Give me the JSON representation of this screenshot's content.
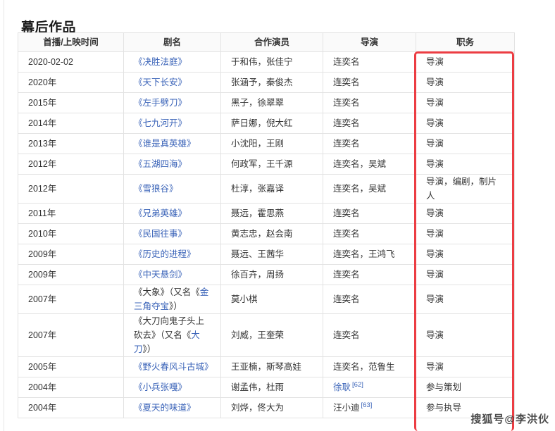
{
  "page": {
    "section_title": "幕后作品",
    "watermark": "搜狐号@李洪伙"
  },
  "annotation": {
    "type": "red-rectangle-highlight",
    "target_column": "职务",
    "color": "#ec3d43"
  },
  "table": {
    "headers": [
      "首播/上映时间",
      "剧名",
      "合作演员",
      "导演",
      "职务"
    ],
    "rows": [
      {
        "date": "2020-02-02",
        "title": "《决胜法庭》",
        "title_link": true,
        "cast": "于和伟，张佳宁",
        "director": "连奕名",
        "director_link": false,
        "role": "导演"
      },
      {
        "date": "2020年",
        "title": "《天下长安》",
        "title_link": true,
        "cast": "张涵予，秦俊杰",
        "director": "连奕名",
        "director_link": false,
        "role": "导演"
      },
      {
        "date": "2015年",
        "title": "《左手劈刀》",
        "title_link": true,
        "cast": "黑子，徐翠翠",
        "director": "连奕名",
        "director_link": false,
        "role": "导演"
      },
      {
        "date": "2014年",
        "title": "《七九河开》",
        "title_link": true,
        "cast": "萨日娜，倪大红",
        "director": "连奕名",
        "director_link": false,
        "role": "导演"
      },
      {
        "date": "2013年",
        "title": "《谁是真英雄》",
        "title_link": true,
        "cast": "小沈阳，王刚",
        "director": "连奕名",
        "director_link": false,
        "role": "导演"
      },
      {
        "date": "2012年",
        "title": "《五湖四海》",
        "title_link": true,
        "cast": "何政军，王千源",
        "director": "连奕名，吴斌",
        "director_link": false,
        "role": "导演"
      },
      {
        "date": "2012年",
        "title": "《雪狼谷》",
        "title_link": true,
        "cast": "杜淳，张嘉译",
        "director": "连奕名，吴斌",
        "director_link": false,
        "role": "导演，编剧，制片人"
      },
      {
        "date": "2011年",
        "title": "《兄弟英雄》",
        "title_link": true,
        "cast": "聂远，霍思燕",
        "director": "连奕名",
        "director_link": false,
        "role": "导演"
      },
      {
        "date": "2010年",
        "title": "《民国往事》",
        "title_link": true,
        "cast": "黄志忠，赵会南",
        "director": "连奕名",
        "director_link": false,
        "role": "导演"
      },
      {
        "date": "2009年",
        "title": "《历史的进程》",
        "title_link": true,
        "cast": "聂远、王茜华",
        "director": "连奕名，王鸿飞",
        "director_link": false,
        "role": "导演"
      },
      {
        "date": "2009年",
        "title": "《中天悬剑》",
        "title_link": true,
        "cast": "徐百卉，周扬",
        "director": "连奕名",
        "director_link": false,
        "role": "导演"
      },
      {
        "date": "2007年",
        "title_parts": [
          {
            "text": "《大象》（又名《",
            "link": false
          },
          {
            "text": "金三角夺宝",
            "link": true
          },
          {
            "text": "》）",
            "link": false
          }
        ],
        "cast": "莫小棋",
        "director": "连奕名",
        "director_link": false,
        "role": "导演",
        "height": "tall"
      },
      {
        "date": "2007年",
        "title_parts": [
          {
            "text": "《大刀向鬼子头上砍去》（又名《",
            "link": false
          },
          {
            "text": "大刀",
            "link": true
          },
          {
            "text": "》）",
            "link": false
          }
        ],
        "cast": "刘威，王奎荣",
        "director": "连奕名",
        "director_link": false,
        "role": "导演",
        "height": "taller"
      },
      {
        "date": "2005年",
        "title": "《野火春风斗古城》",
        "title_link": true,
        "cast": "王亚楠，斯琴高娃",
        "director": "连奕名，范鲁生",
        "director_link": false,
        "role": "导演"
      },
      {
        "date": "2004年",
        "title": "《小兵张嘎》",
        "title_link": true,
        "cast": "谢孟伟，杜雨",
        "director": "徐耿",
        "director_link": true,
        "director_ref": "[62]",
        "role": "参与策划"
      },
      {
        "date": "2004年",
        "title": "《夏天的味道》",
        "title_link": true,
        "cast": "刘烨，佟大为",
        "director": "汪小迪",
        "director_link": false,
        "director_ref": "[63]",
        "role": "参与执导"
      }
    ]
  }
}
